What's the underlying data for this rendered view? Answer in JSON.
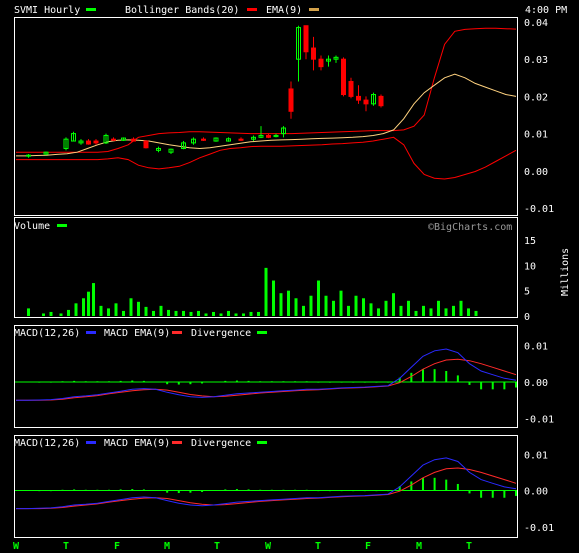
{
  "header": {
    "symbol": "SVMI Hourly",
    "bollinger": "Bollinger Bands(20)",
    "ema": "EMA(9)",
    "time": "4:00 PM"
  },
  "watermark": "©BigCharts.com",
  "colors": {
    "background": "#000000",
    "frame": "#ffffff",
    "up": "#00ff00",
    "down": "#ff0000",
    "band": "#ff0000",
    "ema": "#ffd27f",
    "macd": "#2a2aff",
    "signal": "#ff2a2a"
  },
  "chart_data": [
    {
      "type": "candlestick",
      "title": "SVMI Hourly",
      "legend": [
        "SVMI Hourly",
        "Bollinger Bands(20)",
        "EMA(9)"
      ],
      "y_ticks": [
        "0.04",
        "0.03",
        "0.02",
        "0.01",
        "0.00",
        "-0.01"
      ],
      "ylim": [
        -0.01,
        0.04
      ],
      "x": [
        2,
        5,
        8,
        11,
        14,
        17,
        20,
        23,
        26,
        29,
        32,
        35,
        38,
        41,
        44,
        47,
        50,
        53,
        56,
        59,
        62,
        65,
        68,
        71,
        74,
        77,
        80,
        83,
        86,
        89,
        92,
        95,
        98,
        101,
        104,
        107,
        110,
        113,
        116,
        119,
        122,
        125,
        128,
        131,
        134,
        137,
        140,
        143,
        146,
        149,
        152,
        155,
        158,
        161,
        164,
        167,
        170,
        173,
        176,
        179,
        182,
        185,
        188,
        191,
        194,
        197,
        200
      ],
      "candles": [
        {
          "x": 5,
          "o": 0.004,
          "h": 0.0045,
          "l": 0.0035,
          "c": 0.0042
        },
        {
          "x": 12,
          "o": 0.0045,
          "h": 0.0052,
          "l": 0.0042,
          "c": 0.005
        },
        {
          "x": 20,
          "o": 0.006,
          "h": 0.009,
          "l": 0.0055,
          "c": 0.0085
        },
        {
          "x": 23,
          "o": 0.008,
          "h": 0.0105,
          "l": 0.008,
          "c": 0.01
        },
        {
          "x": 26,
          "o": 0.0075,
          "h": 0.0085,
          "l": 0.007,
          "c": 0.008
        },
        {
          "x": 29,
          "o": 0.008,
          "h": 0.0085,
          "l": 0.007,
          "c": 0.0072
        },
        {
          "x": 32,
          "o": 0.008,
          "h": 0.0085,
          "l": 0.007,
          "c": 0.0075
        },
        {
          "x": 36,
          "o": 0.0075,
          "h": 0.01,
          "l": 0.0072,
          "c": 0.0095
        },
        {
          "x": 39,
          "o": 0.0085,
          "h": 0.009,
          "l": 0.008,
          "c": 0.0082
        },
        {
          "x": 43,
          "o": 0.0082,
          "h": 0.009,
          "l": 0.008,
          "c": 0.0088
        },
        {
          "x": 47,
          "o": 0.0085,
          "h": 0.009,
          "l": 0.008,
          "c": 0.008
        },
        {
          "x": 52,
          "o": 0.008,
          "h": 0.0082,
          "l": 0.006,
          "c": 0.0062
        },
        {
          "x": 57,
          "o": 0.0055,
          "h": 0.0065,
          "l": 0.005,
          "c": 0.006
        },
        {
          "x": 62,
          "o": 0.005,
          "h": 0.006,
          "l": 0.0045,
          "c": 0.0058
        },
        {
          "x": 67,
          "o": 0.006,
          "h": 0.008,
          "l": 0.0058,
          "c": 0.0075
        },
        {
          "x": 71,
          "o": 0.0075,
          "h": 0.009,
          "l": 0.007,
          "c": 0.0085
        },
        {
          "x": 75,
          "o": 0.0085,
          "h": 0.009,
          "l": 0.008,
          "c": 0.0082
        },
        {
          "x": 80,
          "o": 0.008,
          "h": 0.009,
          "l": 0.0078,
          "c": 0.0088
        },
        {
          "x": 85,
          "o": 0.008,
          "h": 0.009,
          "l": 0.0078,
          "c": 0.0086
        },
        {
          "x": 90,
          "o": 0.0085,
          "h": 0.009,
          "l": 0.008,
          "c": 0.0082
        },
        {
          "x": 95,
          "o": 0.0085,
          "h": 0.0095,
          "l": 0.008,
          "c": 0.009
        },
        {
          "x": 98,
          "o": 0.009,
          "h": 0.012,
          "l": 0.0088,
          "c": 0.0095
        },
        {
          "x": 101,
          "o": 0.0095,
          "h": 0.01,
          "l": 0.0088,
          "c": 0.009
        },
        {
          "x": 104,
          "o": 0.0092,
          "h": 0.01,
          "l": 0.009,
          "c": 0.0095
        },
        {
          "x": 107,
          "o": 0.01,
          "h": 0.012,
          "l": 0.009,
          "c": 0.0115
        },
        {
          "x": 110,
          "o": 0.022,
          "h": 0.024,
          "l": 0.014,
          "c": 0.016
        },
        {
          "x": 113,
          "o": 0.03,
          "h": 0.039,
          "l": 0.024,
          "c": 0.0385
        },
        {
          "x": 116,
          "o": 0.039,
          "h": 0.039,
          "l": 0.03,
          "c": 0.032
        },
        {
          "x": 119,
          "o": 0.033,
          "h": 0.036,
          "l": 0.027,
          "c": 0.03
        },
        {
          "x": 122,
          "o": 0.03,
          "h": 0.031,
          "l": 0.027,
          "c": 0.028
        },
        {
          "x": 125,
          "o": 0.0295,
          "h": 0.031,
          "l": 0.028,
          "c": 0.03
        },
        {
          "x": 128,
          "o": 0.03,
          "h": 0.031,
          "l": 0.029,
          "c": 0.0305
        },
        {
          "x": 131,
          "o": 0.03,
          "h": 0.0305,
          "l": 0.02,
          "c": 0.0205
        },
        {
          "x": 134,
          "o": 0.024,
          "h": 0.025,
          "l": 0.0195,
          "c": 0.02
        },
        {
          "x": 137,
          "o": 0.02,
          "h": 0.023,
          "l": 0.018,
          "c": 0.019
        },
        {
          "x": 140,
          "o": 0.019,
          "h": 0.02,
          "l": 0.016,
          "c": 0.018
        },
        {
          "x": 143,
          "o": 0.018,
          "h": 0.021,
          "l": 0.0175,
          "c": 0.0205
        },
        {
          "x": 146,
          "o": 0.02,
          "h": 0.0205,
          "l": 0.017,
          "c": 0.0175
        }
      ],
      "bollinger_upper": [
        0.005,
        0.005,
        0.005,
        0.005,
        0.005,
        0.005,
        0.005,
        0.005,
        0.005,
        0.0052,
        0.006,
        0.007,
        0.009,
        0.0095,
        0.01,
        0.0102,
        0.0103,
        0.0105,
        0.0105,
        0.0104,
        0.0103,
        0.0102,
        0.0101,
        0.01,
        0.01,
        0.01,
        0.01,
        0.01,
        0.0101,
        0.0102,
        0.0103,
        0.0104,
        0.0105,
        0.0106,
        0.0107,
        0.0108,
        0.0108,
        0.0108,
        0.011,
        0.012,
        0.015,
        0.025,
        0.034,
        0.0375,
        0.038,
        0.0382,
        0.0383,
        0.0383,
        0.0382,
        0.0381
      ],
      "bollinger_lower": [
        0.003,
        0.003,
        0.003,
        0.003,
        0.003,
        0.003,
        0.003,
        0.003,
        0.003,
        0.0032,
        0.0035,
        0.003,
        0.0015,
        0.0008,
        0.0005,
        0.0008,
        0.0012,
        0.0022,
        0.0035,
        0.0045,
        0.0055,
        0.006,
        0.0062,
        0.0065,
        0.0066,
        0.0066,
        0.0066,
        0.0067,
        0.0068,
        0.0069,
        0.007,
        0.0072,
        0.0073,
        0.0075,
        0.0077,
        0.008,
        0.0085,
        0.009,
        0.007,
        0.002,
        -0.001,
        -0.002,
        -0.0022,
        -0.0018,
        -0.001,
        -0.0002,
        0.001,
        0.0025,
        0.004,
        0.0055
      ],
      "ema": [
        0.004,
        0.004,
        0.0041,
        0.0042,
        0.0044,
        0.0046,
        0.005,
        0.006,
        0.007,
        0.0078,
        0.0082,
        0.0083,
        0.0082,
        0.008,
        0.0075,
        0.007,
        0.0066,
        0.0062,
        0.006,
        0.0062,
        0.0066,
        0.007,
        0.0074,
        0.0078,
        0.008,
        0.0082,
        0.0083,
        0.0084,
        0.0085,
        0.0086,
        0.0087,
        0.0088,
        0.0089,
        0.009,
        0.0092,
        0.0095,
        0.01,
        0.011,
        0.014,
        0.018,
        0.021,
        0.023,
        0.025,
        0.026,
        0.025,
        0.0235,
        0.0225,
        0.0215,
        0.0205,
        0.02
      ]
    },
    {
      "type": "bar",
      "title": "Volume",
      "ylabel": "Millions",
      "y_ticks": [
        "15",
        "10",
        "5",
        "0"
      ],
      "ylim": [
        0,
        15
      ],
      "bars": [
        {
          "x": 5,
          "v": 1.5
        },
        {
          "x": 11,
          "v": 0.5
        },
        {
          "x": 14,
          "v": 0.8
        },
        {
          "x": 18,
          "v": 0.5
        },
        {
          "x": 21,
          "v": 1.2
        },
        {
          "x": 24,
          "v": 2.5
        },
        {
          "x": 27,
          "v": 3.5
        },
        {
          "x": 29,
          "v": 4.8
        },
        {
          "x": 31,
          "v": 6.5
        },
        {
          "x": 34,
          "v": 2.0
        },
        {
          "x": 37,
          "v": 1.5
        },
        {
          "x": 40,
          "v": 2.5
        },
        {
          "x": 43,
          "v": 1.0
        },
        {
          "x": 46,
          "v": 3.5
        },
        {
          "x": 49,
          "v": 2.8
        },
        {
          "x": 52,
          "v": 1.8
        },
        {
          "x": 55,
          "v": 1.0
        },
        {
          "x": 58,
          "v": 2.0
        },
        {
          "x": 61,
          "v": 1.2
        },
        {
          "x": 64,
          "v": 1.0
        },
        {
          "x": 67,
          "v": 1.0
        },
        {
          "x": 70,
          "v": 0.8
        },
        {
          "x": 73,
          "v": 1.0
        },
        {
          "x": 76,
          "v": 0.5
        },
        {
          "x": 79,
          "v": 0.8
        },
        {
          "x": 82,
          "v": 0.5
        },
        {
          "x": 85,
          "v": 1.0
        },
        {
          "x": 88,
          "v": 0.5
        },
        {
          "x": 91,
          "v": 0.5
        },
        {
          "x": 94,
          "v": 0.8
        },
        {
          "x": 97,
          "v": 0.8
        },
        {
          "x": 100,
          "v": 9.5
        },
        {
          "x": 103,
          "v": 7.0
        },
        {
          "x": 106,
          "v": 4.5
        },
        {
          "x": 109,
          "v": 5.0
        },
        {
          "x": 112,
          "v": 3.5
        },
        {
          "x": 115,
          "v": 2.0
        },
        {
          "x": 118,
          "v": 4.0
        },
        {
          "x": 121,
          "v": 7.0
        },
        {
          "x": 124,
          "v": 4.0
        },
        {
          "x": 127,
          "v": 3.0
        },
        {
          "x": 130,
          "v": 5.0
        },
        {
          "x": 133,
          "v": 2.0
        },
        {
          "x": 136,
          "v": 4.0
        },
        {
          "x": 139,
          "v": 3.5
        },
        {
          "x": 142,
          "v": 2.5
        },
        {
          "x": 145,
          "v": 1.5
        },
        {
          "x": 148,
          "v": 3.0
        },
        {
          "x": 151,
          "v": 4.5
        },
        {
          "x": 154,
          "v": 2.0
        },
        {
          "x": 157,
          "v": 3.0
        },
        {
          "x": 160,
          "v": 1.0
        },
        {
          "x": 163,
          "v": 2.0
        },
        {
          "x": 166,
          "v": 1.5
        },
        {
          "x": 169,
          "v": 3.0
        },
        {
          "x": 172,
          "v": 1.5
        },
        {
          "x": 175,
          "v": 2.0
        },
        {
          "x": 178,
          "v": 3.0
        },
        {
          "x": 181,
          "v": 1.5
        },
        {
          "x": 184,
          "v": 1.0
        }
      ]
    },
    {
      "type": "line",
      "title": "MACD(12,26)",
      "legend": [
        "MACD(12,26)",
        "MACD EMA(9)",
        "Divergence"
      ],
      "y_ticks": [
        "0.01",
        "0.00",
        "-0.01"
      ],
      "ylim": [
        -0.012,
        0.012
      ],
      "macd": [
        -0.005,
        -0.005,
        -0.0049,
        -0.0048,
        -0.0045,
        -0.004,
        -0.0038,
        -0.0035,
        -0.003,
        -0.0025,
        -0.002,
        -0.0018,
        -0.002,
        -0.0028,
        -0.0035,
        -0.004,
        -0.0042,
        -0.004,
        -0.0036,
        -0.0032,
        -0.003,
        -0.0028,
        -0.0026,
        -0.0024,
        -0.0022,
        -0.002,
        -0.002,
        -0.0018,
        -0.0016,
        -0.0015,
        -0.0014,
        -0.0012,
        -0.001,
        0.001,
        0.004,
        0.007,
        0.0085,
        0.009,
        0.008,
        0.005,
        0.003,
        0.002,
        0.001,
        0.0005
      ],
      "signal": [
        -0.005,
        -0.005,
        -0.005,
        -0.0049,
        -0.0047,
        -0.0043,
        -0.004,
        -0.0037,
        -0.0032,
        -0.0028,
        -0.0024,
        -0.0021,
        -0.002,
        -0.0022,
        -0.0028,
        -0.0034,
        -0.0038,
        -0.004,
        -0.0039,
        -0.0036,
        -0.0033,
        -0.003,
        -0.0028,
        -0.0026,
        -0.0024,
        -0.0022,
        -0.0021,
        -0.0019,
        -0.0017,
        -0.0016,
        -0.0015,
        -0.0013,
        -0.0011,
        -0.0002,
        0.0015,
        0.0035,
        0.005,
        0.006,
        0.0062,
        0.0058,
        0.005,
        0.004,
        0.003,
        0.002
      ],
      "divergence": [
        0.0,
        0.0,
        0.0001,
        0.0001,
        0.0002,
        0.0003,
        0.0002,
        0.0002,
        0.0002,
        0.0003,
        0.0004,
        0.0003,
        0.0,
        -0.0006,
        -0.0007,
        -0.0006,
        -0.0004,
        0.0,
        0.0003,
        0.0004,
        0.0003,
        0.0002,
        0.0002,
        0.0002,
        0.0002,
        0.0002,
        0.0001,
        0.0001,
        0.0001,
        0.0001,
        0.0001,
        0.0001,
        0.0001,
        0.0012,
        0.0025,
        0.0035,
        0.0035,
        0.003,
        0.0018,
        -0.0008,
        -0.002,
        -0.002,
        -0.002,
        -0.0015
      ]
    },
    {
      "type": "line",
      "title": "MACD(12,26)",
      "legend": [
        "MACD(12,26)",
        "MACD EMA(9)",
        "Divergence"
      ],
      "y_ticks": [
        "0.01",
        "0.00",
        "-0.01"
      ],
      "ylim": [
        -0.012,
        0.012
      ],
      "macd": [
        -0.005,
        -0.005,
        -0.0049,
        -0.0048,
        -0.0045,
        -0.004,
        -0.0038,
        -0.0035,
        -0.003,
        -0.0025,
        -0.002,
        -0.0018,
        -0.002,
        -0.0028,
        -0.0035,
        -0.004,
        -0.0042,
        -0.004,
        -0.0036,
        -0.0032,
        -0.003,
        -0.0028,
        -0.0026,
        -0.0024,
        -0.0022,
        -0.002,
        -0.002,
        -0.0018,
        -0.0016,
        -0.0015,
        -0.0014,
        -0.0012,
        -0.001,
        0.001,
        0.004,
        0.007,
        0.0085,
        0.009,
        0.008,
        0.005,
        0.003,
        0.002,
        0.001,
        0.0005
      ],
      "signal": [
        -0.005,
        -0.005,
        -0.005,
        -0.0049,
        -0.0047,
        -0.0043,
        -0.004,
        -0.0037,
        -0.0032,
        -0.0028,
        -0.0024,
        -0.0021,
        -0.002,
        -0.0022,
        -0.0028,
        -0.0034,
        -0.0038,
        -0.004,
        -0.0039,
        -0.0036,
        -0.0033,
        -0.003,
        -0.0028,
        -0.0026,
        -0.0024,
        -0.0022,
        -0.0021,
        -0.0019,
        -0.0017,
        -0.0016,
        -0.0015,
        -0.0013,
        -0.0011,
        -0.0002,
        0.0015,
        0.0035,
        0.005,
        0.006,
        0.0062,
        0.0058,
        0.005,
        0.004,
        0.003,
        0.002
      ],
      "divergence": [
        0.0,
        0.0,
        0.0001,
        0.0001,
        0.0002,
        0.0003,
        0.0002,
        0.0002,
        0.0002,
        0.0003,
        0.0004,
        0.0003,
        0.0,
        -0.0006,
        -0.0007,
        -0.0006,
        -0.0004,
        0.0,
        0.0003,
        0.0004,
        0.0003,
        0.0002,
        0.0002,
        0.0002,
        0.0002,
        0.0002,
        0.0001,
        0.0001,
        0.0001,
        0.0001,
        0.0001,
        0.0001,
        0.0001,
        0.0012,
        0.0025,
        0.0035,
        0.0035,
        0.003,
        0.0018,
        -0.0008,
        -0.002,
        -0.002,
        -0.002,
        -0.0015
      ]
    }
  ],
  "x_axis": {
    "labels": [
      "W",
      "T",
      "F",
      "M",
      "T",
      "W",
      "T",
      "F",
      "M",
      "T"
    ]
  }
}
